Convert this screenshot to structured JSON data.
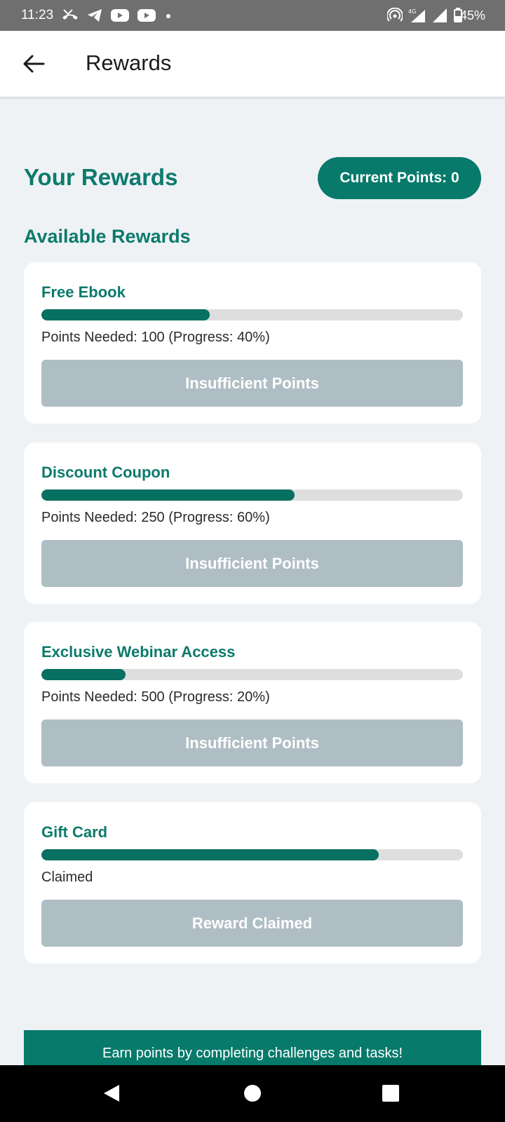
{
  "status_bar": {
    "time": "11:23",
    "left_icons": [
      "missed-call-icon",
      "telegram-icon",
      "youtube-icon",
      "youtube-icon",
      "dot-icon"
    ],
    "right_icons": [
      "hotspot-icon",
      "signal-4g-icon",
      "signal-icon",
      "battery-icon"
    ],
    "network_label": "4G",
    "battery": "45%"
  },
  "app_bar": {
    "back_icon": "arrow-left-icon",
    "title": "Rewards"
  },
  "header": {
    "title": "Your Rewards",
    "points_label": "Current Points: 0"
  },
  "section_title": "Available Rewards",
  "rewards": [
    {
      "title": "Free Ebook",
      "progress": 40,
      "subtitle": "Points Needed: 100 (Progress: 40%)",
      "button": "Insufficient Points"
    },
    {
      "title": "Discount Coupon",
      "progress": 60,
      "subtitle": "Points Needed: 250 (Progress: 60%)",
      "button": "Insufficient Points"
    },
    {
      "title": "Exclusive Webinar Access",
      "progress": 20,
      "subtitle": "Points Needed: 500 (Progress: 20%)",
      "button": "Insufficient Points"
    },
    {
      "title": "Gift Card",
      "progress": 80,
      "subtitle": "Claimed",
      "button": "Reward Claimed"
    }
  ],
  "footer_banner": "Earn points by completing challenges and tasks!",
  "nav_bar": {
    "back": "nav-back-icon",
    "home": "nav-home-icon",
    "recents": "nav-recents-icon"
  },
  "colors": {
    "accent": "#087a6b",
    "progress_fill": "#087060",
    "disabled_button": "#afbec4",
    "background": "#eff2f5"
  }
}
